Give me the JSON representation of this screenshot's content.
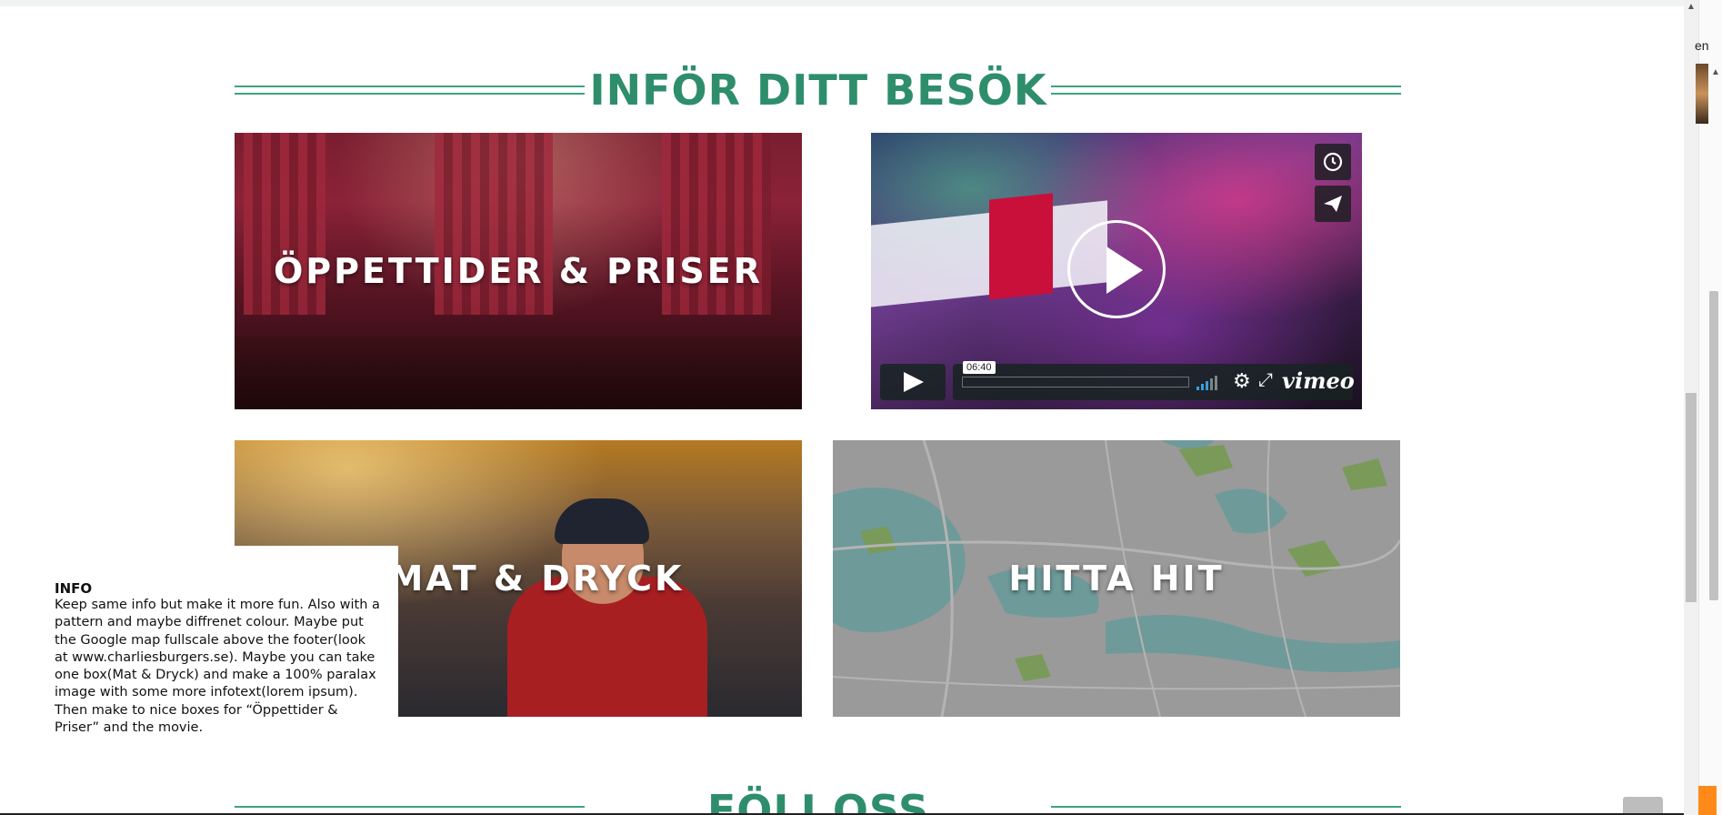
{
  "section": {
    "title": "INFÖR DITT BESÖK"
  },
  "tiles": {
    "hours": {
      "label": "ÖPPETTIDER & PRISER"
    },
    "food": {
      "label": "MAT & DRYCK"
    },
    "map": {
      "label": "HITTA HIT"
    }
  },
  "video": {
    "timecode": "06:40",
    "brand": "vimeo",
    "controls": [
      "play-icon",
      "volume-icon",
      "settings-gear-icon",
      "fullscreen-icon"
    ],
    "side_buttons": [
      "clock-icon",
      "send-icon"
    ]
  },
  "info": {
    "title": "INFO",
    "text": "Keep same info but make it more fun. Also with a pattern and maybe diffrenet colour. Maybe put the Google map fullscale above the footer(look at www.charliesburgers.se). Maybe you can take one box(Mat & Dryck) and make a 100% paralax image with some more infotext(lorem ipsum).  Then make to nice boxes for “Öppettider & Priser” and the movie."
  },
  "next_section": {
    "title": "FÖLJ OSS"
  },
  "sidebar": {
    "language": "en"
  },
  "colors": {
    "accent": "#2e8e6c",
    "map": "#9a9a9a",
    "water": "#6e9a9a",
    "park": "#7a9a5a",
    "orange": "#ff8a1a"
  }
}
